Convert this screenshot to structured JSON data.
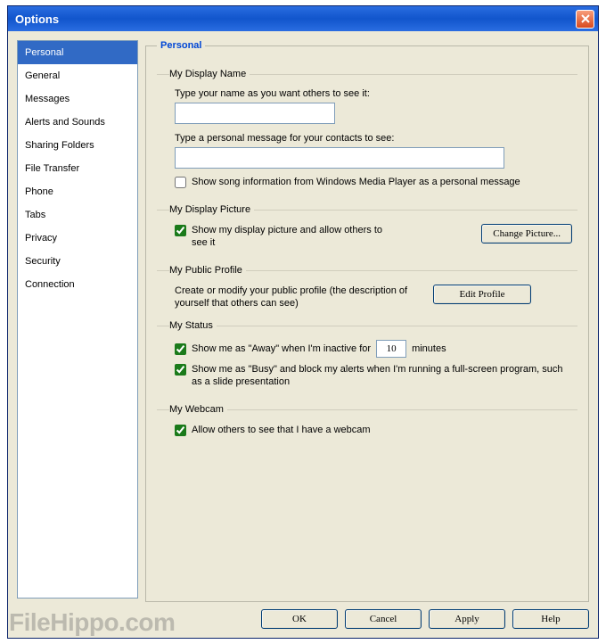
{
  "window": {
    "title": "Options"
  },
  "sidebar": {
    "items": [
      {
        "label": "Personal",
        "selected": true
      },
      {
        "label": "General"
      },
      {
        "label": "Messages"
      },
      {
        "label": "Alerts and Sounds"
      },
      {
        "label": "Sharing Folders"
      },
      {
        "label": "File Transfer"
      },
      {
        "label": "Phone"
      },
      {
        "label": "Tabs"
      },
      {
        "label": "Privacy"
      },
      {
        "label": "Security"
      },
      {
        "label": "Connection"
      }
    ]
  },
  "panel": {
    "title": "Personal",
    "display_name": {
      "legend": "My Display Name",
      "prompt": "Type your name as you want others to see it:",
      "value": "",
      "msg_prompt": "Type a personal message for your contacts to see:",
      "msg_value": "",
      "song_label": "Show song information from Windows Media Player as a personal message",
      "song_checked": false
    },
    "display_picture": {
      "legend": "My Display Picture",
      "show_label": "Show my display picture and allow others to see it",
      "show_checked": true,
      "change_btn": "Change Picture..."
    },
    "public_profile": {
      "legend": "My Public Profile",
      "desc": "Create or modify your public profile (the description of yourself that others can see)",
      "edit_btn": "Edit Profile"
    },
    "status": {
      "legend": "My Status",
      "away_prefix": "Show me as \"Away\" when I'm inactive for",
      "away_value": "10",
      "away_suffix": "minutes",
      "away_checked": true,
      "busy_label": "Show me as \"Busy\" and block my alerts when I'm running a full-screen program, such as a slide presentation",
      "busy_checked": true
    },
    "webcam": {
      "legend": "My Webcam",
      "allow_label": "Allow others to see that I have a webcam",
      "allow_checked": true
    }
  },
  "footer": {
    "ok": "OK",
    "cancel": "Cancel",
    "apply": "Apply",
    "help": "Help"
  },
  "watermark": "FileHippo.com"
}
